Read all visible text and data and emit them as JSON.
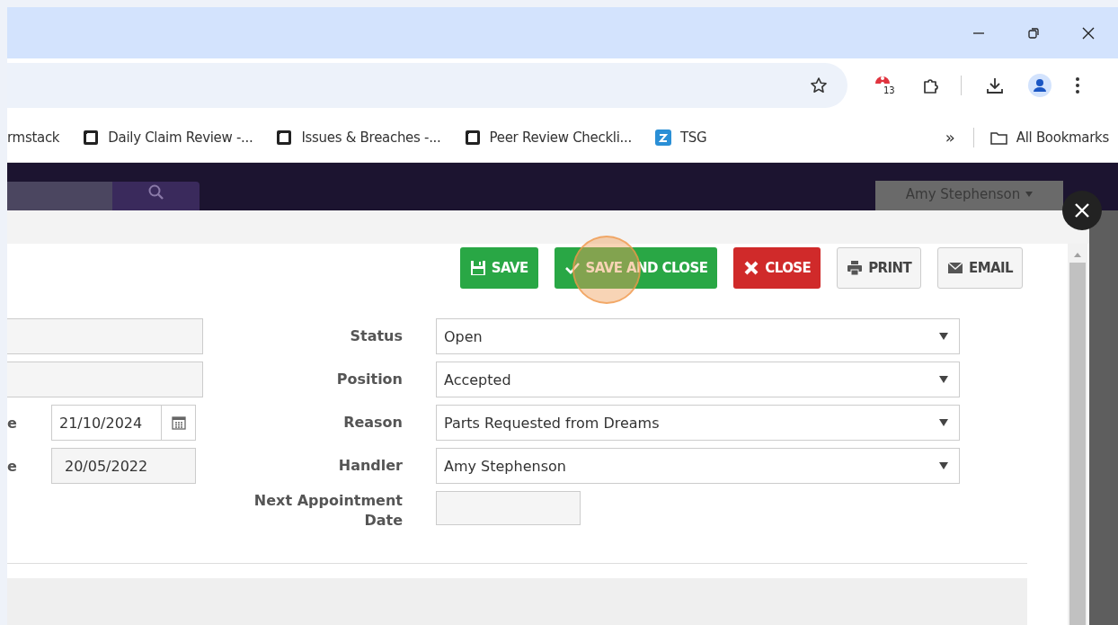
{
  "browser": {
    "extension_badge": "13",
    "bookmarks": [
      {
        "kind": "text",
        "label": "rmstack"
      },
      {
        "kind": "page",
        "label": "Daily Claim Review -..."
      },
      {
        "kind": "page",
        "label": "Issues & Breaches -..."
      },
      {
        "kind": "page",
        "label": "Peer Review Checkli..."
      },
      {
        "kind": "app",
        "label": "TSG"
      }
    ],
    "overflow": "»",
    "all_bookmarks": "All Bookmarks"
  },
  "app_header": {
    "user_menu": "Amy Stephenson"
  },
  "toolbar": [
    {
      "kind": "save",
      "label": "SAVE"
    },
    {
      "kind": "save_close",
      "label": "SAVE AND CLOSE"
    },
    {
      "kind": "close",
      "label": "CLOSE"
    },
    {
      "kind": "print",
      "label": "PRINT"
    },
    {
      "kind": "email",
      "label": "EMAIL"
    }
  ],
  "left_fields": [
    {
      "kind": "text"
    },
    {
      "kind": "text"
    },
    {
      "kind": "date",
      "label": "e",
      "value": "21/10/2024"
    },
    {
      "kind": "readonly",
      "label": "e",
      "value": "20/05/2022"
    }
  ],
  "right_fields": [
    {
      "kind": "select",
      "label": "Status",
      "value": "Open"
    },
    {
      "kind": "select",
      "label": "Position",
      "value": "Accepted"
    },
    {
      "kind": "select",
      "label": "Reason",
      "value": "Parts Requested from Dreams"
    },
    {
      "kind": "select",
      "label": "Handler",
      "value": "Amy Stephenson"
    },
    {
      "kind": "date_empty",
      "label": "Next Appointment Date"
    }
  ]
}
